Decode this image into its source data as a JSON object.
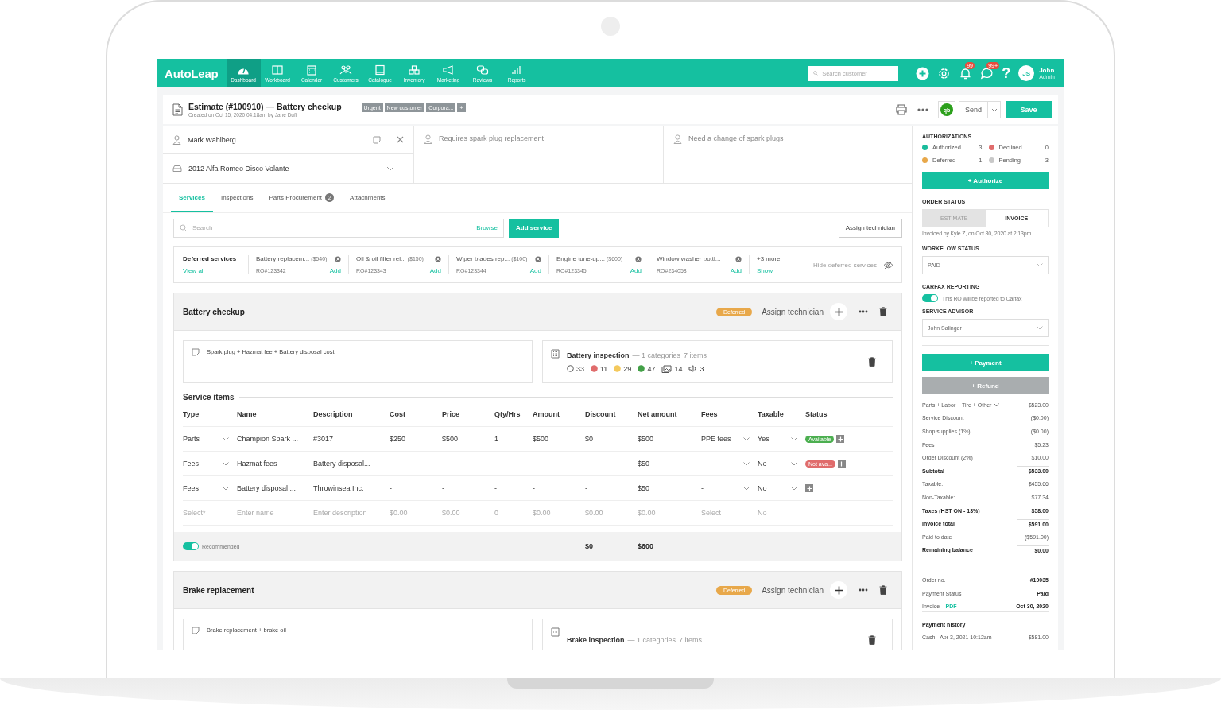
{
  "app": {
    "logo": "AutoLeap",
    "nav": [
      {
        "kind": "dashboard",
        "label": "Dashboard",
        "selected": true
      },
      {
        "kind": "workboard",
        "label": "Workboard",
        "selected": false
      },
      {
        "kind": "calendar",
        "label": "Calendar",
        "selected": false
      },
      {
        "kind": "customers",
        "label": "Customers",
        "selected": false
      },
      {
        "kind": "catalogue",
        "label": "Catalogue",
        "selected": false
      },
      {
        "kind": "inventory",
        "label": "Inventory",
        "selected": false
      },
      {
        "kind": "marketing",
        "label": "Marketing",
        "selected": false
      },
      {
        "kind": "reviews",
        "label": "Reviews",
        "selected": false
      },
      {
        "kind": "reports",
        "label": "Reports",
        "selected": false
      }
    ],
    "search": {
      "placeholder": "Search customer"
    },
    "notifications_badge": "99",
    "messages_badge": "99+",
    "help": "?",
    "user": {
      "initials": "JS",
      "name": "John",
      "role": "Admin"
    }
  },
  "header": {
    "title": "Estimate (#100910) — Battery checkup",
    "created": "Created on Oct 15, 2020 04:18am by Jane Duff",
    "tags": [
      "Urgent",
      "New customer",
      "Corpora..."
    ],
    "add_tag": "+",
    "integration": "qb",
    "send": "Send",
    "save": "Save"
  },
  "info": {
    "customer": "Mark Wahlberg",
    "vehicle": "2012 Alfa Romeo Disco Volante",
    "concern": "Requires spark plug replacement",
    "note": "Need a change of spark plugs"
  },
  "tabs": [
    {
      "label": "Services",
      "selected": true
    },
    {
      "label": "Inspections",
      "selected": false
    },
    {
      "label": "Parts Procurement",
      "selected": false,
      "badge": "2"
    },
    {
      "label": "Attachments",
      "selected": false
    }
  ],
  "toolbar": {
    "search": {
      "placeholder": "Search"
    },
    "browse": "Browse",
    "add_service": "Add service",
    "assign_technician": "Assign technician"
  },
  "deferred": {
    "title": "Deferred services",
    "view_all": "View all",
    "items": [
      {
        "name": "Battery replacem...",
        "price": "($540)",
        "ro": "RO#123342",
        "action": "Add"
      },
      {
        "name": "Oil & oil filter rel...",
        "price": "($150)",
        "ro": "RO#123343",
        "action": "Add"
      },
      {
        "name": "Wiper blades rep...",
        "price": "($100)",
        "ro": "RO#123344",
        "action": "Add"
      },
      {
        "name": "Engine tune-up...",
        "price": "($600)",
        "ro": "RO#123345",
        "action": "Add"
      },
      {
        "name": "Window washer bottl...",
        "ro": "RO#234058",
        "action": "Add"
      }
    ],
    "more": "+3 more",
    "show": "Show",
    "hide": "Hide deferred services"
  },
  "columns": [
    {
      "label": "Type",
      "dropdown": true
    },
    {
      "label": "Name",
      "dropdown": false
    },
    {
      "label": "Description",
      "dropdown": false
    },
    {
      "label": "Cost",
      "dropdown": false
    },
    {
      "label": "Price",
      "dropdown": false
    },
    {
      "label": "Qty/Hrs",
      "dropdown": false
    },
    {
      "label": "Amount",
      "dropdown": false
    },
    {
      "label": "Discount",
      "dropdown": false
    },
    {
      "label": "Net amount",
      "dropdown": false
    },
    {
      "label": "Fees",
      "dropdown": true
    },
    {
      "label": "Taxable",
      "dropdown": true
    },
    {
      "label": "Status",
      "dropdown": false
    }
  ],
  "services": [
    {
      "title": "Battery checkup",
      "status": {
        "kind": "deferred",
        "label": "Deferred"
      },
      "assign": "Assign technician",
      "note": "Spark plug + Hazmat fee + Battery disposal cost",
      "inspection": {
        "title": "Battery inspection",
        "summary": "— 1 categories",
        "items": "7 items",
        "counts": [
          {
            "kind": "unchecked",
            "value": "33"
          },
          {
            "kind": "failed",
            "value": "11"
          },
          {
            "kind": "warning",
            "value": "29"
          },
          {
            "kind": "passed",
            "value": "47"
          },
          {
            "kind": "photos",
            "value": "14"
          },
          {
            "kind": "audio",
            "value": "3"
          }
        ]
      },
      "heading": "Service items",
      "rows": [
        {
          "cells": [
            "Parts",
            "Champion Spark ...",
            "#3017",
            "$250",
            "$500",
            "1",
            "$500",
            "$0",
            "$500",
            "PPE fees",
            "Yes"
          ],
          "status": {
            "kind": "available",
            "label": "Available"
          }
        },
        {
          "cells": [
            "Fees",
            "Hazmat fees",
            "Battery disposal...",
            "-",
            "-",
            "-",
            "-",
            "-",
            "$50",
            "-",
            "No"
          ],
          "status": {
            "kind": "unavailable",
            "label": "Not ava..."
          }
        },
        {
          "cells": [
            "Fees",
            "Battery disposal ...",
            "Throwinsea Inc.",
            "-",
            "-",
            "-",
            "-",
            "-",
            "$50",
            "-",
            "No"
          ]
        }
      ],
      "new_row": {
        "placeholders": [
          "Select*",
          "Enter name",
          "Enter description",
          "$0.00",
          "$0.00",
          "0",
          "$0.00",
          "$0.00",
          "$0.00",
          "Select",
          "No"
        ]
      },
      "footer": {
        "recommended": {
          "label": "Recommended",
          "on": true
        },
        "discount": "$0",
        "net": "$600"
      }
    },
    {
      "title": "Brake replacement",
      "status": {
        "kind": "deferred",
        "label": "Deferred"
      },
      "assign": "Assign technician",
      "note": "Brake replacement + brake oil",
      "inspection": {
        "title": "Brake inspection",
        "summary": "— 1 categories",
        "items": "7 items"
      }
    }
  ],
  "sidebar": {
    "authorizations": {
      "title": "AUTHORIZATIONS",
      "items": [
        {
          "label": "Authorized",
          "count": "3",
          "color": "#1abc9c"
        },
        {
          "label": "Declined",
          "count": "0",
          "color": "#e06c6c"
        },
        {
          "label": "Deferred",
          "count": "1",
          "color": "#e8a84a"
        },
        {
          "label": "Pending",
          "count": "3",
          "color": "#c8c8c8"
        }
      ],
      "button": "+ Authorize"
    },
    "order_status": {
      "title": "ORDER STATUS",
      "options": [
        {
          "label": "ESTIMATE",
          "selected": false
        },
        {
          "label": "INVOICE",
          "selected": true
        }
      ],
      "note": "Invoiced by Kyle Z, on Oct 30, 2020 at 2:13pm"
    },
    "workflow": {
      "title": "WORKFLOW STATUS",
      "value": "PAID"
    },
    "carfax": {
      "title": "CARFAX REPORTING",
      "on": true,
      "label": "This RO will be reported to Carfax"
    },
    "advisor": {
      "title": "SERVICE ADVISOR",
      "value": "John Salinger"
    },
    "payment": "+ Payment",
    "refund": {
      "label": "+ Refund",
      "disabled": true
    },
    "totals": [
      {
        "kind": "dropdown",
        "label": "Parts + Labor + Tire + Other",
        "value": "$523.00"
      },
      {
        "kind": "plain",
        "label": "Service Discount",
        "value": "($0.00)"
      },
      {
        "kind": "plain",
        "label": "Shop supplies (1%)",
        "value": "($0.00)"
      },
      {
        "kind": "plain",
        "label": "Fees",
        "value": "$5.23"
      },
      {
        "kind": "plain",
        "label": "Order Discount (2%)",
        "value": "$10.00"
      },
      {
        "kind": "bold",
        "label": "Subtotal",
        "value": "$533.00"
      },
      {
        "kind": "plain",
        "label": "Taxable:",
        "value": "$455.66"
      },
      {
        "kind": "plain",
        "label": "Non-Taxable:",
        "value": "$77.34"
      },
      {
        "kind": "bold",
        "label": "Taxes (HST ON - 13%)",
        "value": "$58.00"
      },
      {
        "kind": "bold",
        "label": "Invoice total",
        "value": "$591.00"
      },
      {
        "kind": "plain",
        "label": "Paid to date",
        "value": "($591.00)"
      },
      {
        "kind": "bold",
        "label": "Remaining balance",
        "value": "$0.00"
      }
    ],
    "order": [
      {
        "label": "Order no.",
        "value": "#10035"
      },
      {
        "label": "Payment Status",
        "value": "Paid"
      },
      {
        "label": "Invoice -",
        "link": "PDF",
        "value": "Oct 30, 2020"
      }
    ],
    "history": {
      "title": "Payment history",
      "entries": [
        {
          "label": "Cash - Apr 3, 2021 10:12am",
          "value": "$581.00"
        }
      ]
    }
  }
}
